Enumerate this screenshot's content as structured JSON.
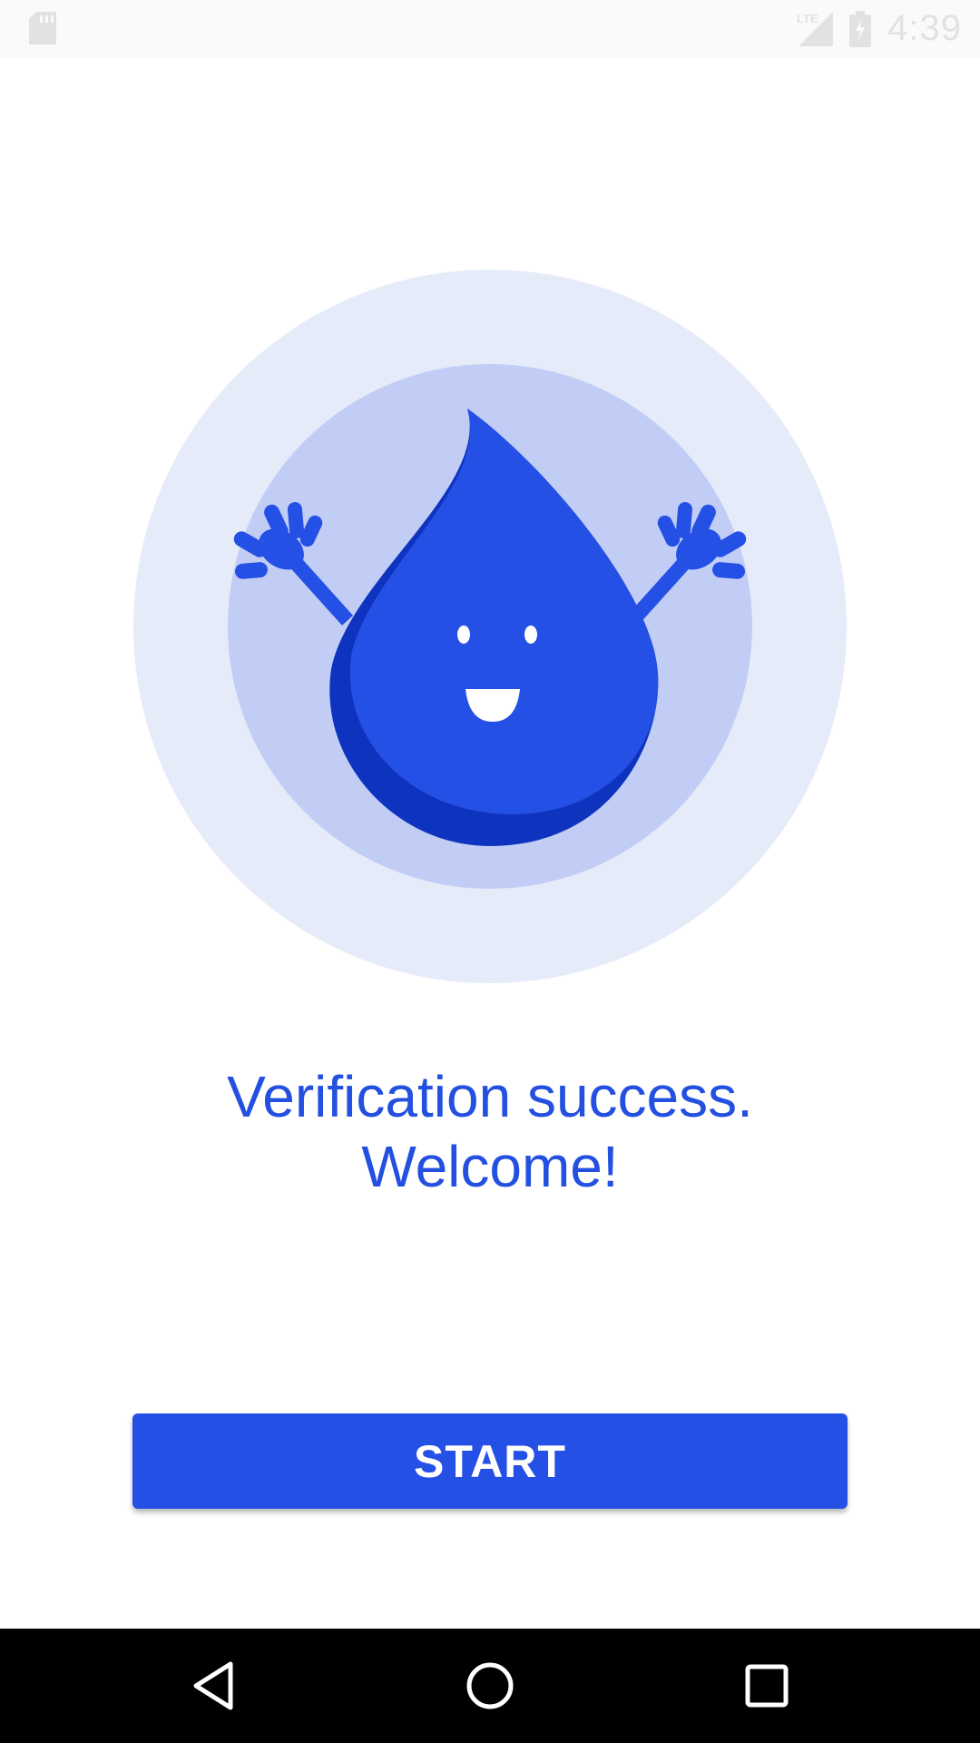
{
  "status_bar": {
    "time": "4:39",
    "network_label": "LTE",
    "icons": [
      "sd-card-icon",
      "signal-icon",
      "battery-icon"
    ]
  },
  "message": {
    "line1": "Verification success.",
    "line2": "Welcome!"
  },
  "start_button": {
    "label": "START"
  },
  "nav_bar": {
    "icons": [
      "back-icon",
      "home-icon",
      "recents-icon"
    ]
  },
  "colors": {
    "accent": "#2550E5",
    "accent_dark": "#0E33BE",
    "circle_outer": "#E6EBFA",
    "circle_inner": "#C1CDF5",
    "status_bar_bg": "#FAFAFA",
    "nav_bar_bg": "#000000"
  }
}
